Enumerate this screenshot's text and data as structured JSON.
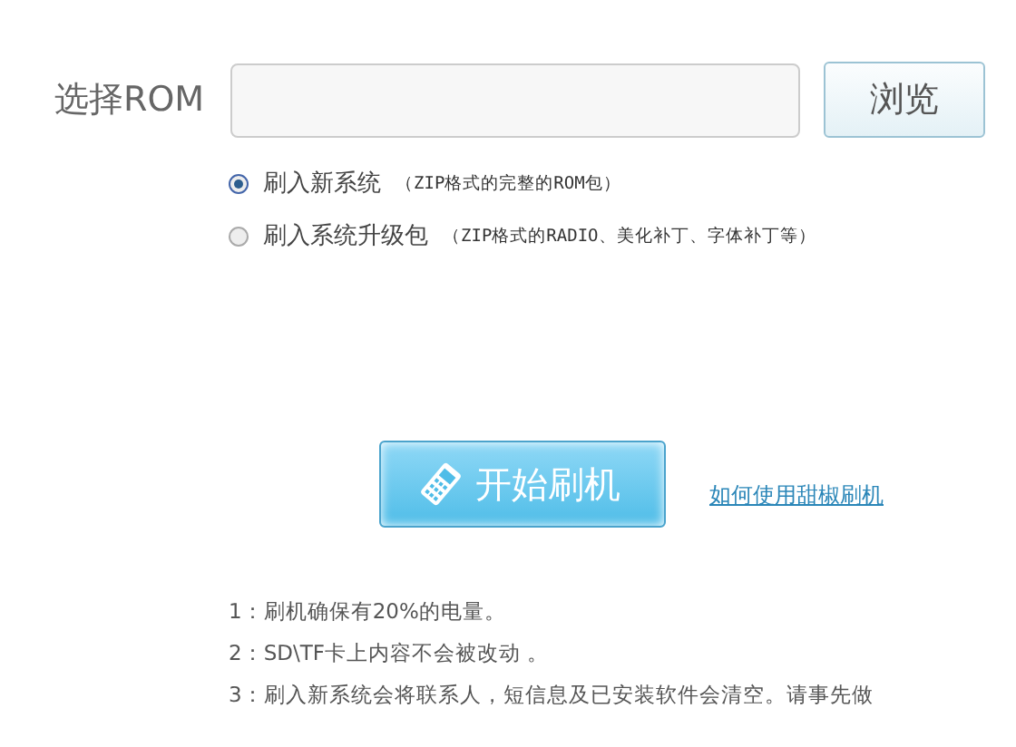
{
  "rom_field": {
    "label": "选择ROM",
    "browse_button": "浏览"
  },
  "options": [
    {
      "label": "刷入新系统",
      "note": "（ZIP格式的完整的ROM包）",
      "selected": true
    },
    {
      "label": "刷入系统升级包",
      "note": "（ZIP格式的RADIO、美化补丁、字体补丁等）",
      "selected": false
    }
  ],
  "start_button": "开始刷机",
  "help_link": "如何使用甜椒刷机",
  "notes": [
    "1：刷机确保有20%的电量。",
    "2：SD\\TF卡上内容不会被改动 。",
    "3：刷入新系统会将联系人，短信息及已安装软件会清空。请事先做"
  ]
}
